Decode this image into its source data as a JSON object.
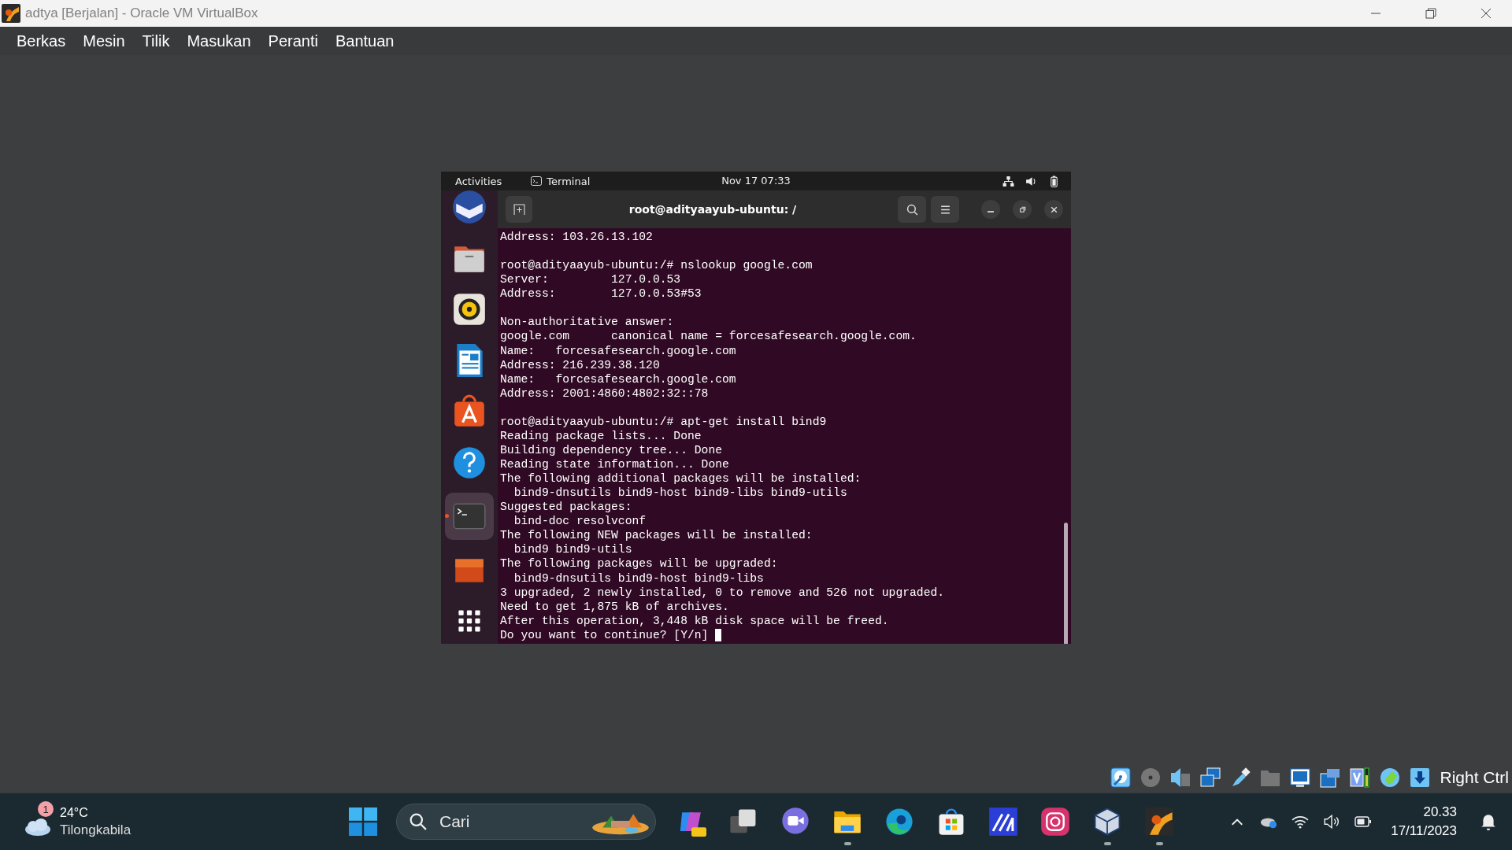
{
  "window": {
    "title": "adtya [Berjalan] - Oracle VM VirtualBox"
  },
  "menu": [
    "Berkas",
    "Mesin",
    "Tilik",
    "Masukan",
    "Peranti",
    "Bantuan"
  ],
  "vm": {
    "top_bar": {
      "activities": "Activities",
      "app": "Terminal",
      "clock": "Nov 17  07:33"
    },
    "dock": [
      {
        "kind": "mail",
        "selected": false
      },
      {
        "kind": "files",
        "selected": false
      },
      {
        "kind": "music",
        "selected": false
      },
      {
        "kind": "writer",
        "selected": false
      },
      {
        "kind": "store",
        "selected": false
      },
      {
        "kind": "help",
        "selected": false
      },
      {
        "kind": "terminal",
        "selected": true
      },
      {
        "kind": "slides",
        "selected": false
      },
      {
        "kind": "apps",
        "selected": false
      }
    ],
    "terminal": {
      "title": "root@adityaayub-ubuntu: /",
      "cursor": true,
      "blocks": [
        [
          "Address: 103.26.13.102"
        ],
        [
          "root@adityaayub-ubuntu:/# nslookup google.com",
          "Server:         127.0.0.53",
          "Address:        127.0.0.53#53"
        ],
        [
          "Non-authoritative answer:",
          "google.com      canonical name = forcesafesearch.google.com.",
          "Name:   forcesafesearch.google.com",
          "Address: 216.239.38.120",
          "Name:   forcesafesearch.google.com",
          "Address: 2001:4860:4802:32::78"
        ],
        [
          "root@adityaayub-ubuntu:/# apt-get install bind9",
          "Reading package lists... Done",
          "Building dependency tree... Done",
          "Reading state information... Done",
          "The following additional packages will be installed:",
          "  bind9-dnsutils bind9-host bind9-libs bind9-utils",
          "Suggested packages:",
          "  bind-doc resolvconf",
          "The following NEW packages will be installed:",
          "  bind9 bind9-utils",
          "The following packages will be upgraded:",
          "  bind9-dnsutils bind9-host bind9-libs",
          "3 upgraded, 2 newly installed, 0 to remove and 526 not upgraded.",
          "Need to get 1,875 kB of archives.",
          "After this operation, 3,448 kB disk space will be freed.",
          "Do you want to continue? [Y/n] "
        ]
      ]
    }
  },
  "status_bar": {
    "host_key": "Right Ctrl"
  },
  "taskbar": {
    "weather": {
      "badge": "1",
      "temperature": "24°C",
      "place": "Tilongkabila"
    },
    "search": {
      "placeholder": "Cari"
    },
    "apps": [
      {
        "kind": "copilot",
        "running": false
      },
      {
        "kind": "taskview",
        "running": false
      },
      {
        "kind": "meet",
        "running": false
      },
      {
        "kind": "explorer",
        "running": true
      },
      {
        "kind": "edge",
        "running": false
      },
      {
        "kind": "store",
        "running": false
      },
      {
        "kind": "ai",
        "running": false
      },
      {
        "kind": "instagram",
        "running": false
      },
      {
        "kind": "virtualbox",
        "running": true
      },
      {
        "kind": "vm",
        "running": true
      }
    ],
    "clock": {
      "time": "20.33",
      "date": "17/11/2023"
    }
  }
}
